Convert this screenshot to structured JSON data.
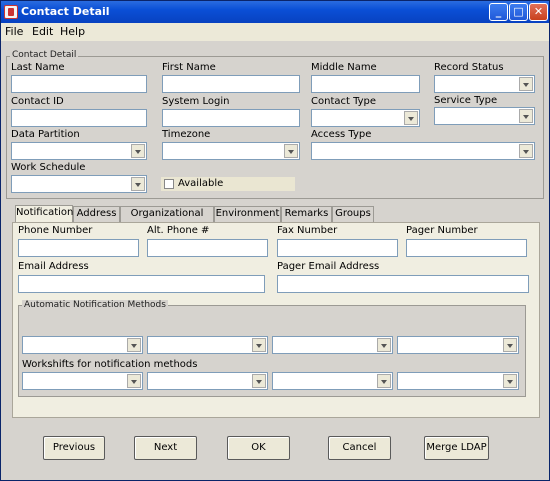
{
  "window": {
    "title": "Contact Detail",
    "min": "_",
    "max": "□",
    "close": "✕"
  },
  "menu": [
    "File",
    "Edit",
    "Help"
  ],
  "contact": {
    "legend": "Contact Detail",
    "last_name_label": "Last Name",
    "first_name_label": "First Name",
    "middle_name_label": "Middle Name",
    "record_status_label": "Record Status",
    "contact_id_label": "Contact ID",
    "system_login_label": "System Login",
    "contact_type_label": "Contact Type",
    "service_type_label": "Service Type",
    "data_partition_label": "Data Partition",
    "timezone_label": "Timezone",
    "access_type_label": "Access Type",
    "work_schedule_label": "Work Schedule",
    "available_label": "Available"
  },
  "tabs": [
    "Notification",
    "Address",
    "Organizational Info",
    "Environment",
    "Remarks",
    "Groups"
  ],
  "notification": {
    "phone_label": "Phone Number",
    "alt_phone_label": "Alt. Phone #",
    "fax_label": "Fax Number",
    "pager_label": "Pager Number",
    "email_label": "Email Address",
    "pager_email_label": "Pager Email Address",
    "methods_legend": "Automatic Notification Methods",
    "workshifts_label": "Workshifts for notification methods"
  },
  "buttons": {
    "previous": "Previous",
    "next": "Next",
    "ok": "OK",
    "cancel": "Cancel",
    "merge_ldap": "Merge LDAP"
  }
}
